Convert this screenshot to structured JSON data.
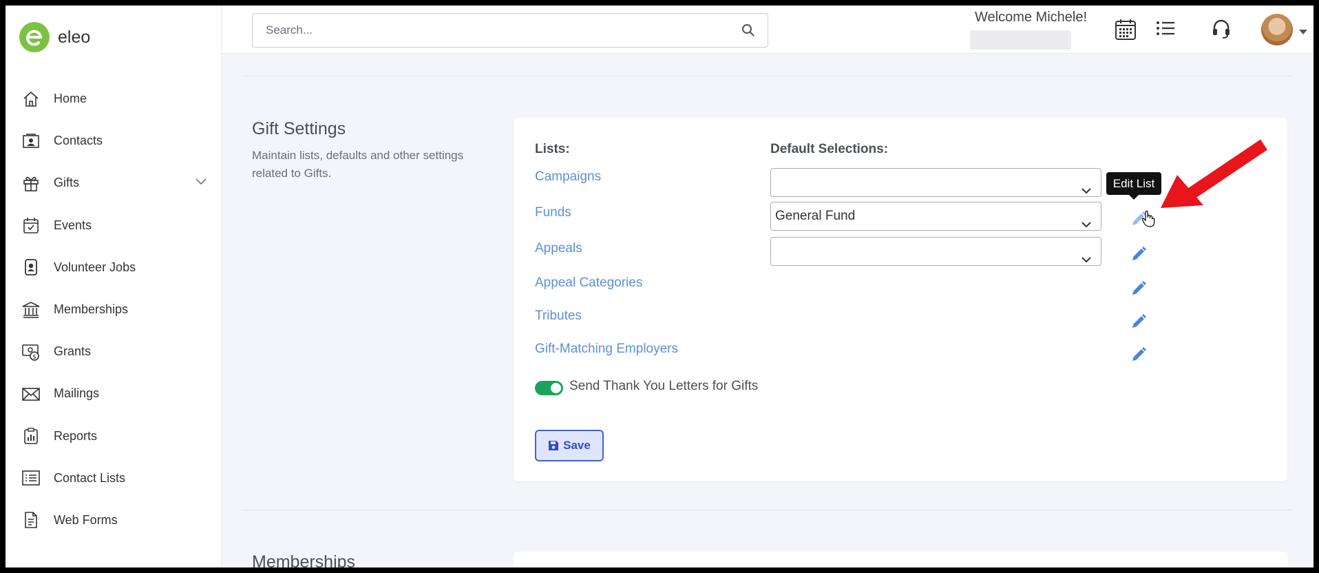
{
  "app": {
    "logo_text": "eleo",
    "logo_letter": "e"
  },
  "sidebar": {
    "items": [
      {
        "label": "Home",
        "icon": "home-icon"
      },
      {
        "label": "Contacts",
        "icon": "contact-card-icon"
      },
      {
        "label": "Gifts",
        "icon": "gift-icon"
      },
      {
        "label": "Events",
        "icon": "calendar-check-icon"
      },
      {
        "label": "Volunteer Jobs",
        "icon": "badge-icon"
      },
      {
        "label": "Memberships",
        "icon": "institution-icon"
      },
      {
        "label": "Grants",
        "icon": "money-icon"
      },
      {
        "label": "Mailings",
        "icon": "envelope-icon"
      },
      {
        "label": "Reports",
        "icon": "report-icon"
      },
      {
        "label": "Contact Lists",
        "icon": "list-icon"
      },
      {
        "label": "Web Forms",
        "icon": "form-icon"
      }
    ]
  },
  "topbar": {
    "search_placeholder": "Search...",
    "welcome": "Welcome Michele!"
  },
  "gift_settings": {
    "title": "Gift Settings",
    "description": "Maintain lists, defaults and other settings related to Gifts.",
    "lists_header": "Lists:",
    "defaults_header": "Default Selections:",
    "rows": [
      {
        "label": "Campaigns",
        "default": ""
      },
      {
        "label": "Funds",
        "default": "General Fund"
      },
      {
        "label": "Appeals",
        "default": ""
      },
      {
        "label": "Appeal Categories"
      },
      {
        "label": "Tributes"
      },
      {
        "label": "Gift-Matching Employers"
      }
    ],
    "tooltip": "Edit List",
    "toggle_label": "Send Thank You Letters for Gifts",
    "toggle_on": true,
    "save_label": "Save"
  },
  "next_section": {
    "title": "Memberships"
  },
  "colors": {
    "accent_green": "#7cc242",
    "link_blue": "#5b8fd9",
    "toggle_green": "#1aa35e",
    "save_blue": "#2f4bcc",
    "arrow_red": "#e8151b"
  }
}
